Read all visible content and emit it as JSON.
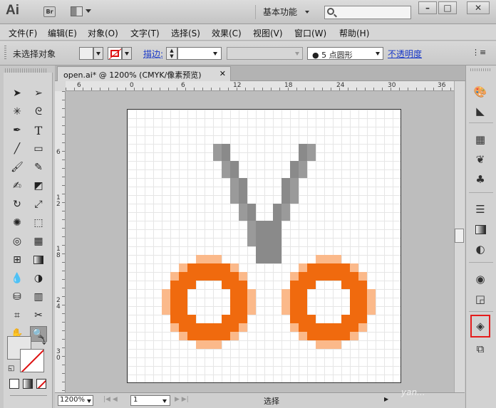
{
  "app": {
    "logo": "Ai",
    "bridge": "Br",
    "workspace": "基本功能",
    "search_placeholder": ""
  },
  "window": {
    "minimize": "–",
    "maximize": "□",
    "close": "✕"
  },
  "menus": [
    "文件(F)",
    "编辑(E)",
    "对象(O)",
    "文字(T)",
    "选择(S)",
    "效果(C)",
    "视图(V)",
    "窗口(W)",
    "帮助(H)"
  ],
  "control": {
    "selection": "未选择对象",
    "stroke_label": "描边:",
    "stroke_value": "",
    "brush_value": "● 5 点圆形",
    "opacity_link": "不透明度"
  },
  "document": {
    "tab": "open.ai* @ 1200% (CMYK/像素预览)",
    "close": "✕"
  },
  "ruler": {
    "h_ticks": [
      "6",
      "0",
      "6",
      "12",
      "18",
      "24",
      "30",
      "36"
    ],
    "v_ticks": [
      "6",
      "1 2",
      "1 8",
      "2 4",
      "3 0"
    ]
  },
  "status": {
    "zoom": "1200%",
    "artboard": "1",
    "tool": "选择",
    "watermark": "yan..."
  },
  "colors": {
    "orange": "#f06a0e",
    "orange_light": "#fbb98a",
    "gray": "#9a9a9a",
    "gray_dark": "#8a8a8a",
    "highlight": "#e41c1c"
  },
  "tools": [
    "selection-arrow",
    "direct-selection",
    "magic-wand",
    "lasso",
    "pen",
    "type",
    "line",
    "rectangle",
    "paintbrush",
    "pencil",
    "blob-brush",
    "eraser",
    "rotate",
    "scale",
    "warp",
    "free-transform",
    "shape-builder",
    "perspective-grid",
    "mesh",
    "gradient",
    "eyedropper",
    "blend",
    "symbol-sprayer",
    "column-graph",
    "artboard",
    "slice",
    "hand",
    "zoom"
  ]
}
